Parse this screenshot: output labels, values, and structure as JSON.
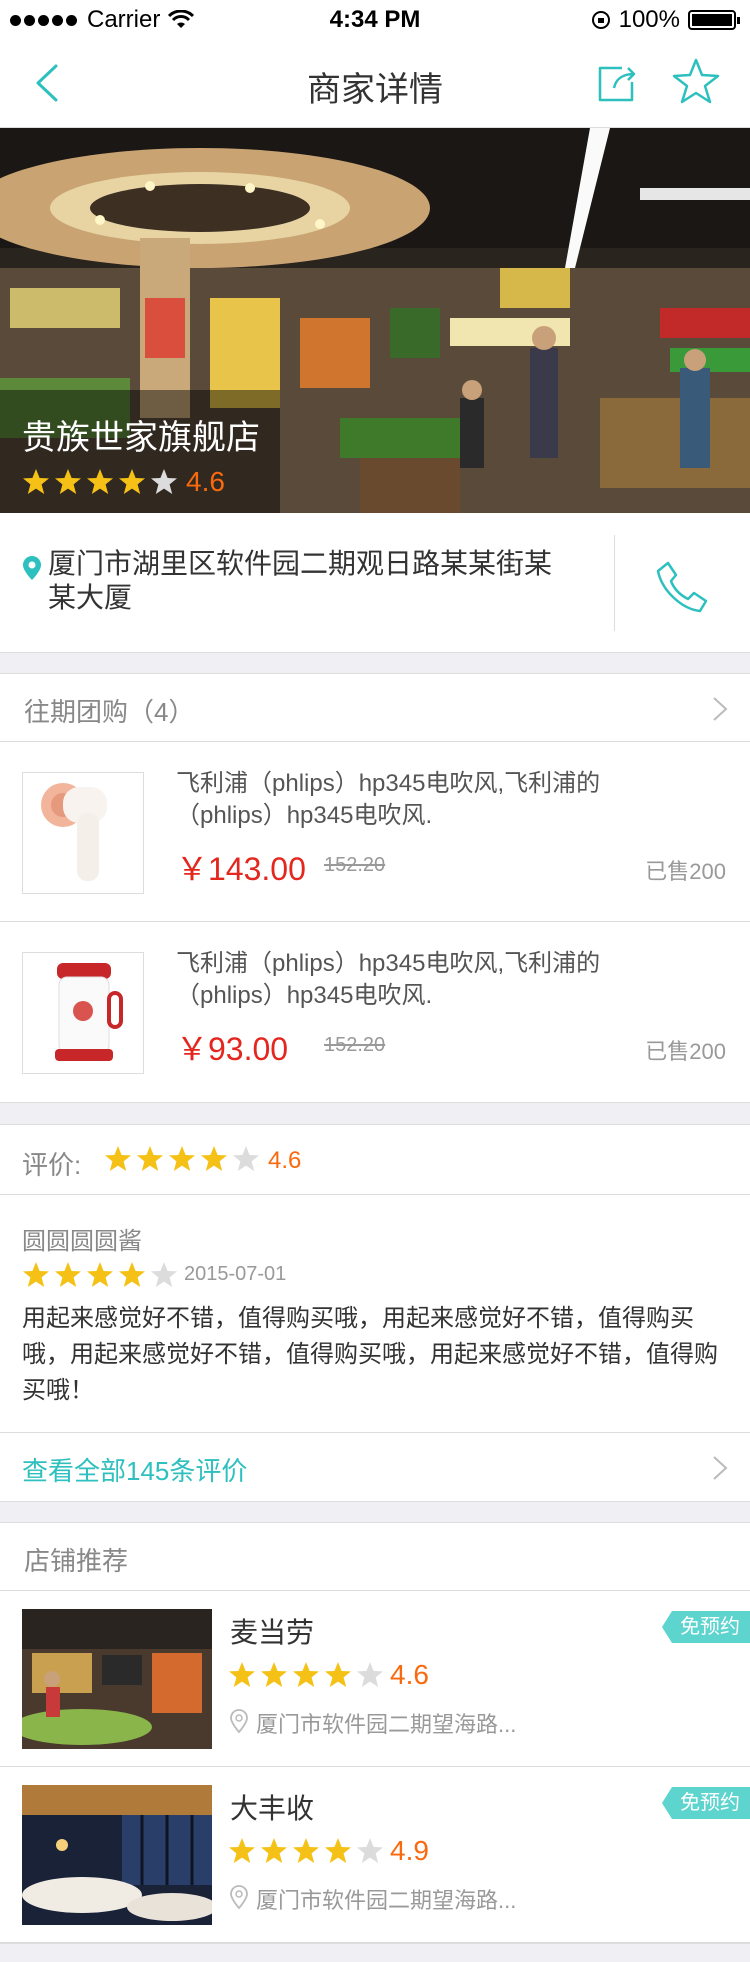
{
  "status_bar": {
    "carrier": "Carrier",
    "time": "4:34 PM",
    "battery": "100%"
  },
  "nav": {
    "title": "商家详情"
  },
  "shop": {
    "name": "贵族世家旗舰店",
    "rating_value": 4.6,
    "rating": "4.6",
    "address": "厦门市湖里区软件园二期观日路某某街某某大厦"
  },
  "deals": {
    "header": "往期团购（4）",
    "items": [
      {
        "title": "飞利浦（phlips）hp345电吹风,飞利浦的（phlips）hp345电吹风.",
        "price": "￥143.00",
        "original": "152.20",
        "sold": "已售200"
      },
      {
        "title": "飞利浦（phlips）hp345电吹风,飞利浦的（phlips）hp345电吹风.",
        "price": "￥93.00",
        "original": "152.20",
        "sold": "已售200"
      }
    ]
  },
  "reviews": {
    "label": "评价:",
    "rating_value": 4.6,
    "rating": "4.6",
    "item": {
      "user": "圆圆圆圆酱",
      "stars": 4,
      "date": "2015-07-01",
      "text": "用起来感觉好不错，值得购买哦，用起来感觉好不错，值得购买哦，用起来感觉好不错，值得购买哦，用起来感觉好不错，值得购买哦！"
    },
    "see_all": "查看全部145条评价"
  },
  "recommend": {
    "header": "店铺推荐",
    "items": [
      {
        "name": "麦当劳",
        "rating_value": 4.6,
        "rating": "4.6",
        "location": "厦门市软件园二期望海路...",
        "badge": "免预约"
      },
      {
        "name": "大丰收",
        "rating_value": 4.9,
        "rating": "4.9",
        "location": "厦门市软件园二期望海路...",
        "badge": "免预约"
      }
    ]
  },
  "colors": {
    "accent": "#2ebfbf",
    "price": "#e3271e",
    "rating": "#f96a0e",
    "star": "#f5c116",
    "badge": "#5ed4cf"
  },
  "icons": [
    "back-icon",
    "share-icon",
    "favorite-star-icon",
    "location-pin-icon",
    "phone-icon",
    "chevron-right-icon",
    "star-icon"
  ]
}
